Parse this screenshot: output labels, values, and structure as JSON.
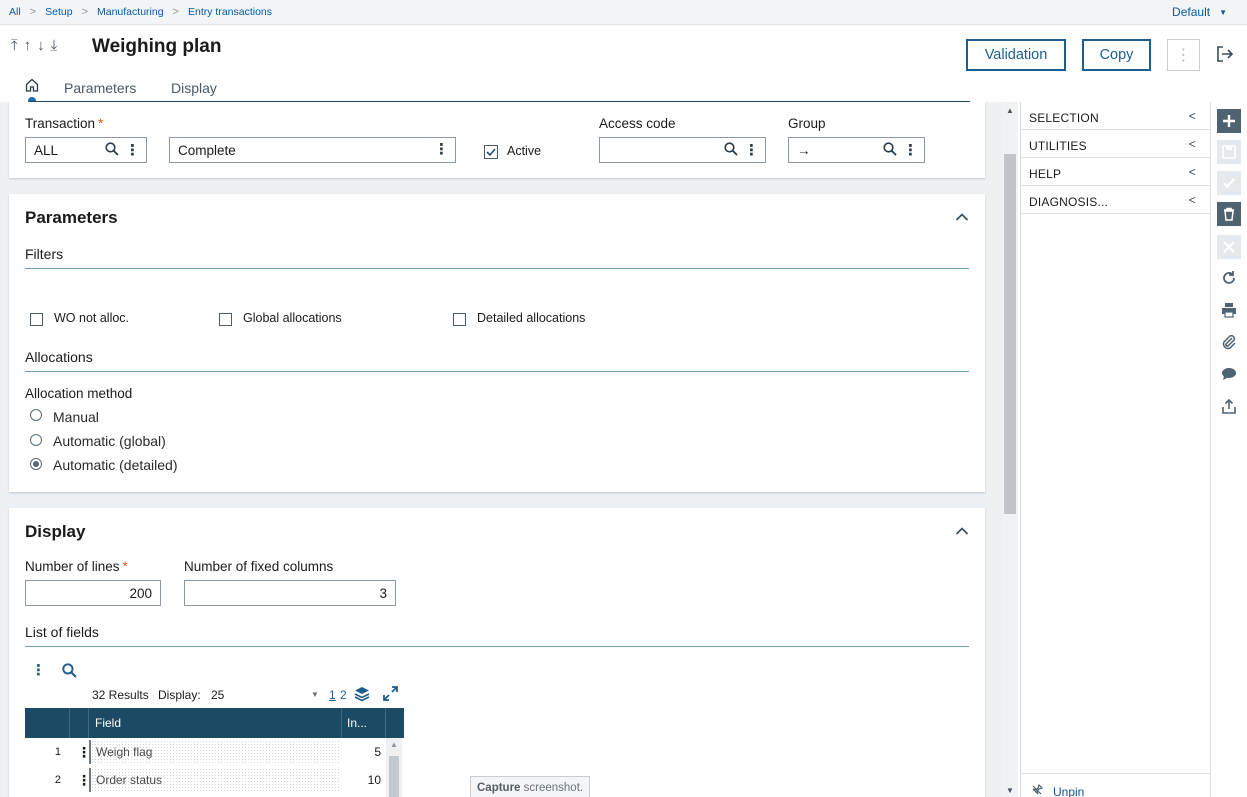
{
  "breadcrumb": [
    "All",
    "Setup",
    "Manufacturing",
    "Entry transactions"
  ],
  "default_menu": "Default",
  "page_title": "Weighing plan",
  "buttons": {
    "validation": "Validation",
    "copy": "Copy"
  },
  "tabs": [
    "Parameters",
    "Display"
  ],
  "header": {
    "transaction_label": "Transaction",
    "transaction_value": "ALL",
    "description_value": "Complete",
    "active_label": "Active",
    "active_checked": true,
    "access_code_label": "Access code",
    "access_code_value": "",
    "group_label": "Group",
    "group_value": "→"
  },
  "parameters": {
    "title": "Parameters",
    "filters_title": "Filters",
    "checkboxes": [
      "WO not alloc.",
      "Global allocations",
      "Detailed allocations"
    ],
    "allocations_title": "Allocations",
    "allocation_method_label": "Allocation method",
    "radios": [
      {
        "label": "Manual",
        "selected": false
      },
      {
        "label": "Automatic (global)",
        "selected": false
      },
      {
        "label": "Automatic (detailed)",
        "selected": true
      }
    ]
  },
  "display": {
    "title": "Display",
    "lines_label": "Number of lines",
    "lines_value": "200",
    "fixed_cols_label": "Number of fixed columns",
    "fixed_cols_value": "3",
    "list_title": "List of fields",
    "results": "32 Results",
    "display_label": "Display:",
    "display_value": "25",
    "page_current": "1",
    "page_next": "2",
    "columns": [
      "Field",
      "In..."
    ],
    "rows": [
      {
        "num": "1",
        "field": "Weigh flag",
        "value": "5"
      },
      {
        "num": "2",
        "field": "Order status",
        "value": "10"
      }
    ]
  },
  "right_panel": {
    "items": [
      "SELECTION",
      "UTILITIES",
      "HELP",
      "DIAGNOSIS..."
    ],
    "unpin": "Unpin"
  },
  "tooltip": {
    "bold": "Capture",
    "rest": " screenshot."
  },
  "colors": {
    "accent": "#1d5e8e",
    "grid_header": "#1c4963",
    "required": "#e35b16"
  }
}
